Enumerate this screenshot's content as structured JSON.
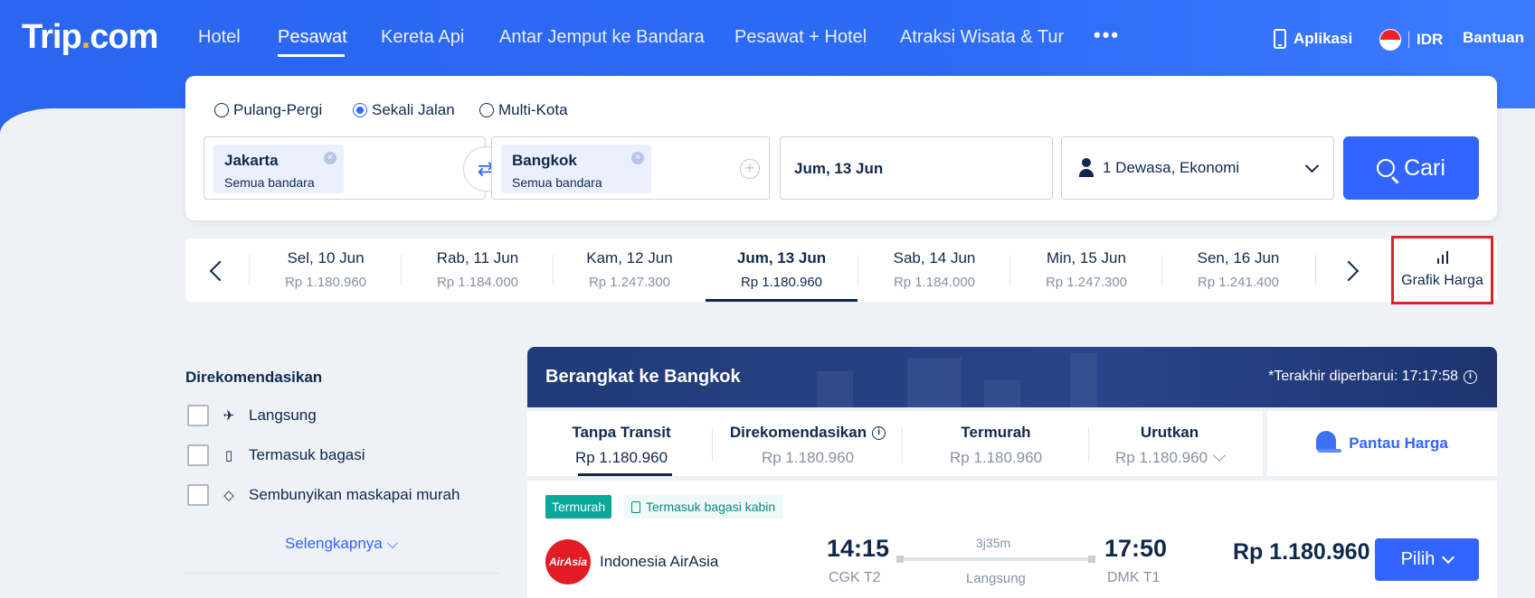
{
  "brand": {
    "logo_main": "Trip",
    "logo_dot": ".",
    "logo_suffix": "com"
  },
  "nav": {
    "items": [
      {
        "label": "Hotel"
      },
      {
        "label": "Pesawat",
        "active": true
      },
      {
        "label": "Kereta Api"
      },
      {
        "label": "Antar Jemput ke Bandara"
      },
      {
        "label": "Pesawat + Hotel"
      },
      {
        "label": "Atraksi Wisata & Tur"
      }
    ],
    "more": "•••",
    "app_label": "Aplikasi",
    "currency": "IDR",
    "help": "Bantuan"
  },
  "search": {
    "trip_types": [
      {
        "label": "Pulang-Pergi",
        "checked": false
      },
      {
        "label": "Sekali Jalan",
        "checked": true
      },
      {
        "label": "Multi-Kota",
        "checked": false
      }
    ],
    "origin": {
      "city": "Jakarta",
      "sub": "Semua bandara"
    },
    "destination": {
      "city": "Bangkok",
      "sub": "Semua bandara"
    },
    "date": "Jum, 13 Jun",
    "passengers": "1 Dewasa, Ekonomi",
    "button": "Cari"
  },
  "date_strip": {
    "dates": [
      {
        "day": "Sel, 10 Jun",
        "price": "Rp 1.180.960"
      },
      {
        "day": "Rab, 11 Jun",
        "price": "Rp 1.184.000"
      },
      {
        "day": "Kam, 12 Jun",
        "price": "Rp 1.247.300"
      },
      {
        "day": "Jum, 13 Jun",
        "price": "Rp 1.180.960",
        "active": true
      },
      {
        "day": "Sab, 14 Jun",
        "price": "Rp 1.184.000"
      },
      {
        "day": "Min, 15 Jun",
        "price": "Rp 1.247.300"
      },
      {
        "day": "Sen, 16 Jun",
        "price": "Rp 1.241.400"
      }
    ],
    "chart_label": "Grafik Harga"
  },
  "filters": {
    "title": "Direkomendasikan",
    "items": [
      {
        "label": "Langsung",
        "icon": "plane-icon"
      },
      {
        "label": "Termasuk bagasi",
        "icon": "luggage-icon"
      },
      {
        "label": "Sembunyikan maskapai murah",
        "icon": "tag-icon"
      }
    ],
    "more": "Selengkapnya"
  },
  "results": {
    "title": "Berangkat ke Bangkok",
    "updated": "*Terakhir diperbarui: 17:17:58",
    "sort": [
      {
        "label": "Tanpa Transit",
        "value": "Rp 1.180.960",
        "active": true
      },
      {
        "label": "Direkomendasikan",
        "value": "Rp 1.180.960"
      },
      {
        "label": "Termurah",
        "value": "Rp 1.180.960"
      },
      {
        "label": "Urutkan",
        "value": "Rp 1.180.960"
      }
    ],
    "watch_price": "Pantau Harga",
    "flight": {
      "tag_cheapest": "Termurah",
      "tag_baggage": "Termasuk bagasi kabin",
      "airline_logo": "AirAsia",
      "airline": "Indonesia AirAsia",
      "depart_time": "14:15",
      "depart_airport": "CGK T2",
      "duration": "3j35m",
      "stops": "Langsung",
      "arrive_time": "17:50",
      "arrive_airport": "DMK T1",
      "price": "Rp 1.180.960",
      "select": "Pilih"
    }
  },
  "colors": {
    "brand_blue": "#3264ff",
    "header_blue": "#2a66f0",
    "navy": "#0f294d",
    "teal": "#0aa79b",
    "highlight_red": "#e0212a"
  }
}
